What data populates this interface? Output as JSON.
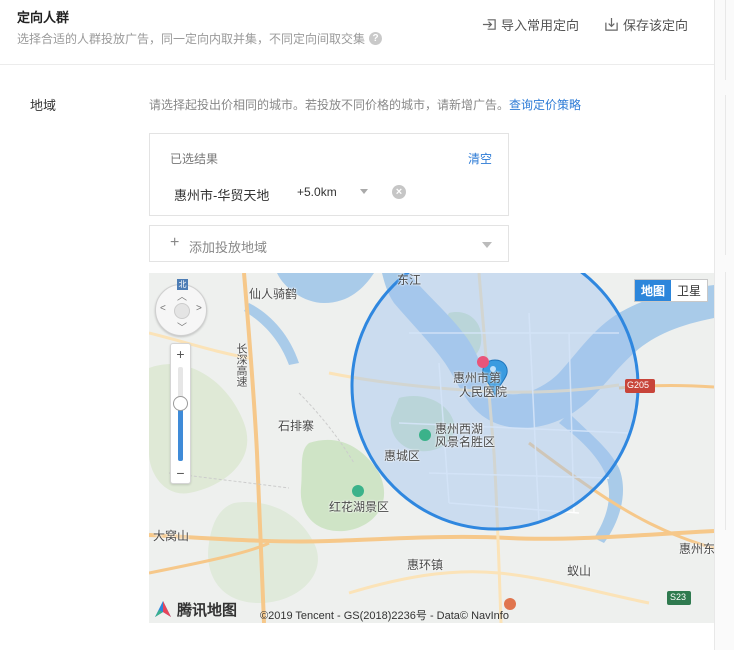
{
  "header": {
    "title": "定向人群",
    "subtitle": "选择合适的人群投放广告，同一定向内取并集，不同定向间取交集",
    "help_icon": "?",
    "import_label": "导入常用定向",
    "save_label": "保存该定向"
  },
  "region": {
    "label": "地域",
    "hint": "请选择起投出价相同的城市。若投放不同价格的城市，请新增广告。",
    "hint_link": "查询定价策略",
    "selected": {
      "title": "已选结果",
      "clear_label": "清空",
      "city": "惠州市-华贸天地",
      "radius": "+5.0km",
      "remove_icon": "×"
    },
    "add_label": "添加投放地域"
  },
  "map": {
    "compass_north": "北",
    "zoom_in": "+",
    "zoom_out": "−",
    "zoom_level_fraction": 0.62,
    "type_map": "地图",
    "type_satellite": "卫星",
    "logo_text": "腾讯地图",
    "copyright": "©2019 Tencent - GS(2018)2236号 - Data© NavInfo",
    "places": {
      "xianrenqi": "仙人骑鹤",
      "changshen": "长深高速",
      "shipaizhai": "石排寨",
      "huicheng": "惠城区",
      "xihu": "惠州西湖",
      "xihu2": "风景名胜区",
      "hongshuhu": "红花湖景区",
      "hospital1": "惠州市第",
      "hospital2": "人民医院",
      "dajiaoshan": "大窝山",
      "huihuanzhen": "惠环镇",
      "qiushan": "蚁山",
      "huizhoudong": "惠州东",
      "g205": "G205",
      "s23": "S23",
      "dongjiang": "东江"
    }
  },
  "colors": {
    "accent": "#2d7bd6",
    "circle_stroke": "#2f87df",
    "circle_fill": "#9fc3ef"
  }
}
